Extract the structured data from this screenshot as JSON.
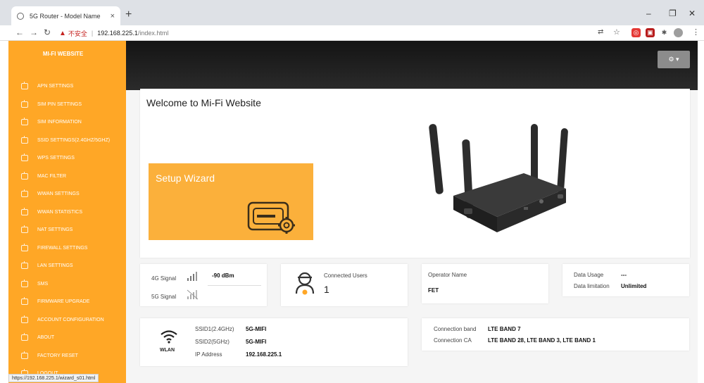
{
  "browser": {
    "tab_title": "5G Router - Model Name",
    "address_warning": "不安全",
    "address_host": "192.168.225.1",
    "address_path": "/index.html",
    "status_url": "https://192.168.225.1/wizard_s01.html"
  },
  "sidebar": {
    "brand": "MI-FI WEBSITE",
    "items": [
      {
        "label": "APN SETTINGS"
      },
      {
        "label": "SIM PIN SETTINGS"
      },
      {
        "label": "SIM INFORMATION"
      },
      {
        "label": "SSID SETTINGS(2.4GHZ/5GHZ)"
      },
      {
        "label": "WPS SETTINGS"
      },
      {
        "label": "MAC FILTER"
      },
      {
        "label": "WWAN SETTINGS"
      },
      {
        "label": "WWAN STATISTICS"
      },
      {
        "label": "NAT SETTINGS"
      },
      {
        "label": "FIREWALL SETTINGS"
      },
      {
        "label": "LAN SETTINGS"
      },
      {
        "label": "SMS"
      },
      {
        "label": "FIRMWARE UPGRADE"
      },
      {
        "label": "ACCOUNT CONFIGURATION"
      },
      {
        "label": "ABOUT"
      },
      {
        "label": "FACTORY RESET"
      },
      {
        "label": "LOGOUT"
      }
    ]
  },
  "header": {
    "settings_icon": "gear-icon"
  },
  "welcome": {
    "title": "Welcome to Mi-Fi Website",
    "wizard_label": "Setup Wizard"
  },
  "signal": {
    "label_4g": "4G Signal",
    "value_4g": "-90 dBm",
    "label_5g": "5G Signal"
  },
  "users": {
    "label": "Connected Users",
    "count": "1"
  },
  "operator": {
    "label": "Operator Name",
    "value": "FET"
  },
  "data": {
    "usage_label": "Data Usage",
    "usage_value": "---",
    "limit_label": "Data limitation",
    "limit_value": "Unlimited"
  },
  "wlan": {
    "icon_label": "WLAN",
    "ssid1_label": "SSID1(2.4GHz)",
    "ssid1_value": "5G-MIFI",
    "ssid2_label": "SSID2(5GHz)",
    "ssid2_value": "5G-MIFI",
    "ip_label": "IP Address",
    "ip_value": "192.168.225.1"
  },
  "connection": {
    "band_label": "Connection band",
    "band_value": "LTE BAND 7",
    "ca_label": "Connection CA",
    "ca_value": "LTE BAND 28, LTE BAND 3, LTE BAND 1"
  },
  "colors": {
    "accent": "#ffa726",
    "wizard": "#fbb03b",
    "header": "#1f1f1f"
  }
}
